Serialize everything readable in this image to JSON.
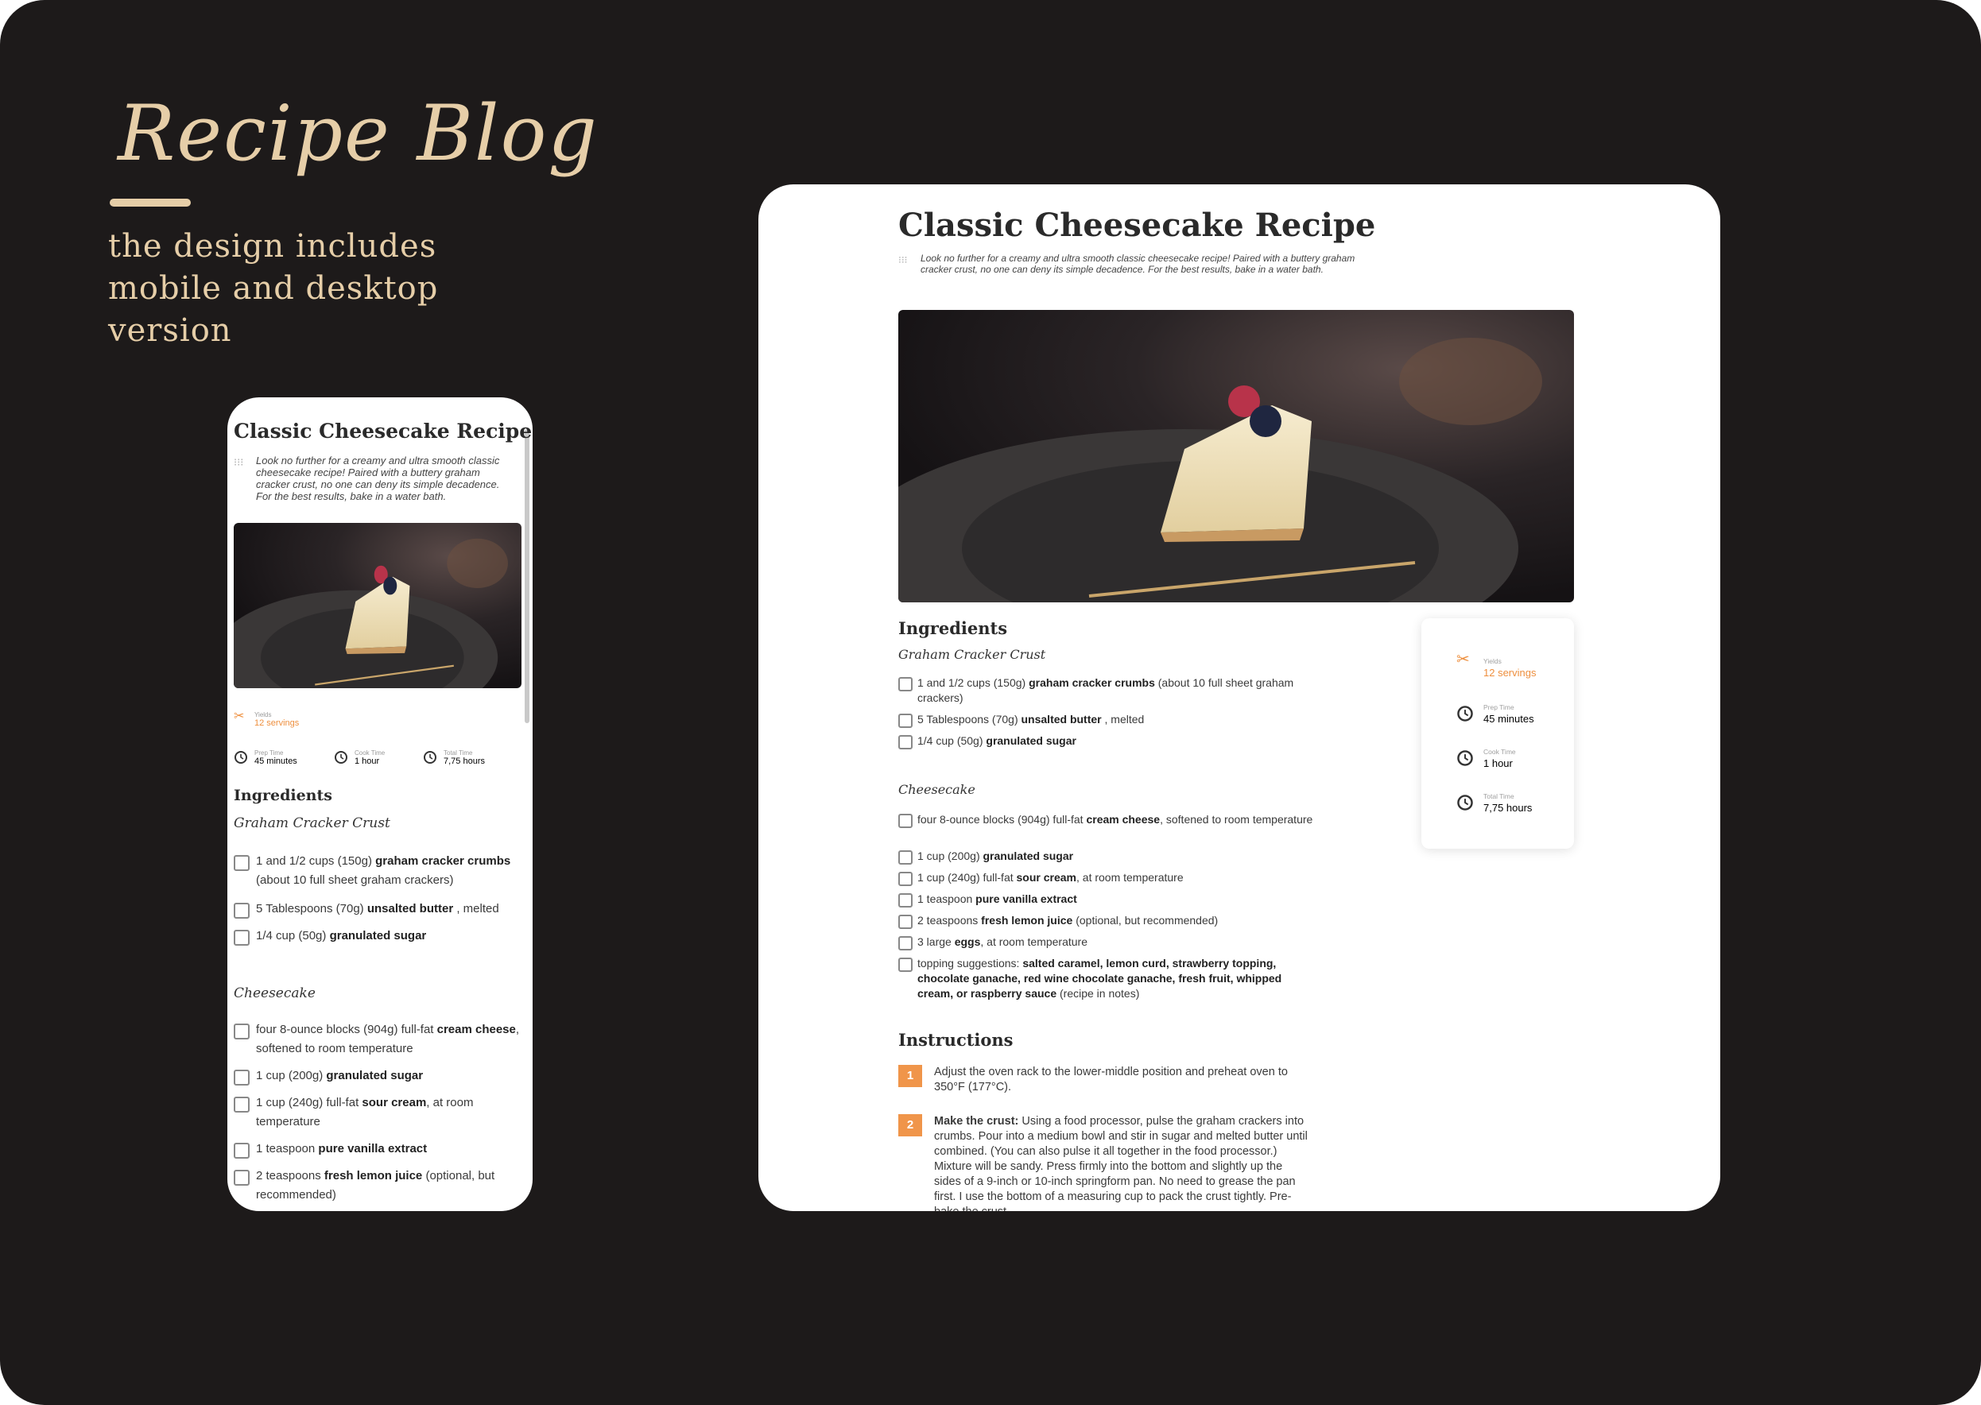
{
  "showcase": {
    "title": "Recipe Blog",
    "subtitle": "the design includes mobile and desktop version"
  },
  "colors": {
    "background": "#1d1a1a",
    "accent_gold": "#e6cea8",
    "accent_orange": "#ee8f3e",
    "step_orange": "#f0954a"
  },
  "recipe": {
    "title": "Classic Cheesecake Recipe",
    "description": "Look no further for a creamy and ultra smooth classic cheesecake recipe! Paired with a buttery graham cracker crust, no one can deny its simple decadence. For the best results, bake in a water bath.",
    "stats": {
      "yields_label": "Yields",
      "yields_value": "12 servings",
      "prep_label": "Prep Time",
      "prep_value": "45 minutes",
      "cook_label": "Cook Time",
      "cook_value": "1 hour",
      "total_label": "Total Time",
      "total_value": "7,75 hours"
    },
    "ingredients_heading": "Ingredients",
    "crust_heading": "Graham Cracker Crust",
    "crust": [
      {
        "pre": "1 and 1/2 cups (150g) ",
        "bold": "graham cracker crumbs",
        "post": " (about 10 full sheet graham crackers)"
      },
      {
        "pre": "5 Tablespoons (70g) ",
        "bold": "unsalted butter",
        "post": " , melted"
      },
      {
        "pre": "1/4 cup (50g) ",
        "bold": "granulated sugar",
        "post": ""
      }
    ],
    "cheesecake_heading": "Cheesecake",
    "cheesecake": [
      {
        "pre": "four 8-ounce blocks (904g) full-fat ",
        "bold": "cream cheese",
        "post": ", softened to room temperature"
      },
      {
        "pre": "1 cup (200g) ",
        "bold": "granulated sugar",
        "post": ""
      },
      {
        "pre": "1 cup (240g) full-fat ",
        "bold": "sour cream",
        "post": ", at room temperature"
      },
      {
        "pre": "1 teaspoon ",
        "bold": "pure vanilla extract",
        "post": ""
      },
      {
        "pre": "2 teaspoons ",
        "bold": "fresh lemon juice",
        "post": " (optional, but recommended)"
      },
      {
        "pre": "3 large ",
        "bold": "eggs",
        "post": ", at room temperature"
      },
      {
        "pre": "topping suggestions: ",
        "bold": "salted caramel, lemon curd, strawberry topping, chocolate ganache, red wine chocolate ganache, fresh fruit, whipped cream, or raspberry sauce",
        "post": " (recipe in notes)"
      }
    ],
    "instructions_heading": "Instructions",
    "steps": [
      {
        "num": "1",
        "bold": "",
        "text": "Adjust the oven rack to the lower-middle position and preheat oven to 350°F (177°C)."
      },
      {
        "num": "2",
        "bold": "Make the crust:",
        "text": " Using a food processor, pulse the graham crackers into crumbs. Pour into a medium bowl and stir in sugar and melted butter until combined. (You can also pulse it all together in the food processor.) Mixture will be sandy. Press firmly into the bottom and slightly up the sides of a 9-inch or 10-inch springform pan. No need to grease the pan first. I use the bottom of a measuring cup to pack the crust tightly. Pre-bake the crust."
      }
    ]
  },
  "icons": {
    "yields": "fork-knife-icon",
    "time": "clock-icon",
    "description": "grip-icon",
    "checkbox": "checkbox-icon"
  }
}
